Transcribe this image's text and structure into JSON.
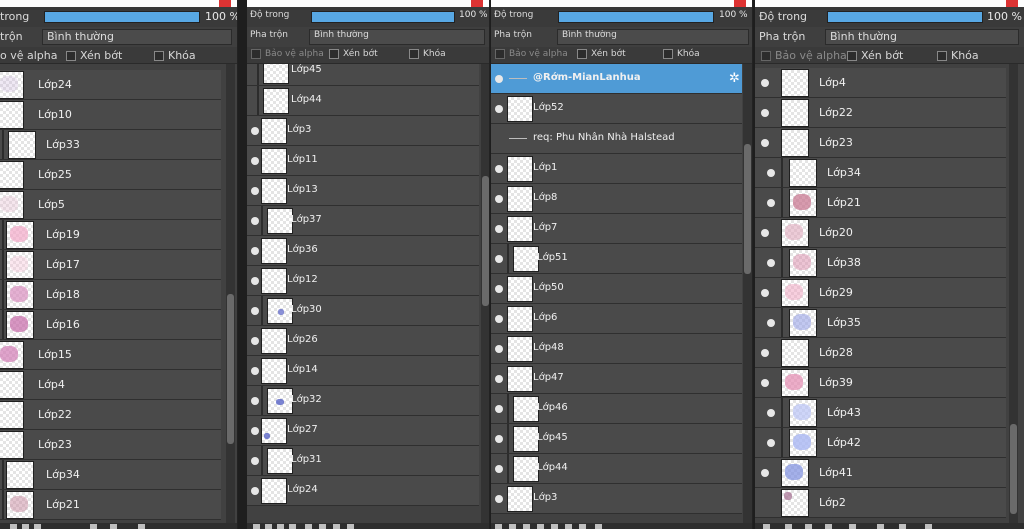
{
  "labels": {
    "opacity": "Độ trong",
    "blend": "Pha trộn",
    "blend_value": "Bình thường",
    "percent": "100 %",
    "protect_alpha": "Bảo vệ alpha",
    "clip": "Xén bớt",
    "lock": "Khóa"
  },
  "panel1": {
    "opacity_label": "trong",
    "blend_label": "trộn",
    "protect_alpha": "o vệ alpha",
    "layers": [
      {
        "name": "Lớp24"
      },
      {
        "name": "Lớp10"
      },
      {
        "name": "Lớp33"
      },
      {
        "name": "Lớp25"
      },
      {
        "name": "Lớp5"
      },
      {
        "name": "Lớp19"
      },
      {
        "name": "Lớp17"
      },
      {
        "name": "Lớp18"
      },
      {
        "name": "Lớp16"
      },
      {
        "name": "Lớp15"
      },
      {
        "name": "Lớp4"
      },
      {
        "name": "Lớp22"
      },
      {
        "name": "Lớp23"
      },
      {
        "name": "Lớp34"
      },
      {
        "name": "Lớp21"
      }
    ]
  },
  "panel2": {
    "layers": [
      {
        "name": "Lớp45"
      },
      {
        "name": "Lớp44"
      },
      {
        "name": "Lớp3"
      },
      {
        "name": "Lớp11"
      },
      {
        "name": "Lớp13"
      },
      {
        "name": "Lớp37"
      },
      {
        "name": "Lớp36"
      },
      {
        "name": "Lớp12"
      },
      {
        "name": "Lớp30"
      },
      {
        "name": "Lớp26"
      },
      {
        "name": "Lớp14"
      },
      {
        "name": "Lớp32"
      },
      {
        "name": "Lớp27"
      },
      {
        "name": "Lớp31"
      },
      {
        "name": "Lớp24"
      }
    ]
  },
  "panel3": {
    "layers": [
      {
        "name": "@Rớm-MianLanhua"
      },
      {
        "name": "Lớp52"
      },
      {
        "name": "req: Phu Nhân Nhà Halstead"
      },
      {
        "name": "Lớp1"
      },
      {
        "name": "Lớp8"
      },
      {
        "name": "Lớp7"
      },
      {
        "name": "Lớp51"
      },
      {
        "name": "Lớp50"
      },
      {
        "name": "Lớp6"
      },
      {
        "name": "Lớp48"
      },
      {
        "name": "Lớp47"
      },
      {
        "name": "Lớp46"
      },
      {
        "name": "Lớp45"
      },
      {
        "name": "Lớp44"
      },
      {
        "name": "Lớp3"
      }
    ]
  },
  "panel4": {
    "layers": [
      {
        "name": "Lớp4"
      },
      {
        "name": "Lớp22"
      },
      {
        "name": "Lớp23"
      },
      {
        "name": "Lớp34"
      },
      {
        "name": "Lớp21"
      },
      {
        "name": "Lớp20"
      },
      {
        "name": "Lớp38"
      },
      {
        "name": "Lớp29"
      },
      {
        "name": "Lớp35"
      },
      {
        "name": "Lớp28"
      },
      {
        "name": "Lớp39"
      },
      {
        "name": "Lớp43"
      },
      {
        "name": "Lớp42"
      },
      {
        "name": "Lớp41"
      },
      {
        "name": "Lớp2"
      }
    ]
  },
  "colors": {
    "accent": "#58a8e4",
    "selected_row": "#4f9bd6",
    "row": "#4a4a4a",
    "panel": "#414141"
  }
}
